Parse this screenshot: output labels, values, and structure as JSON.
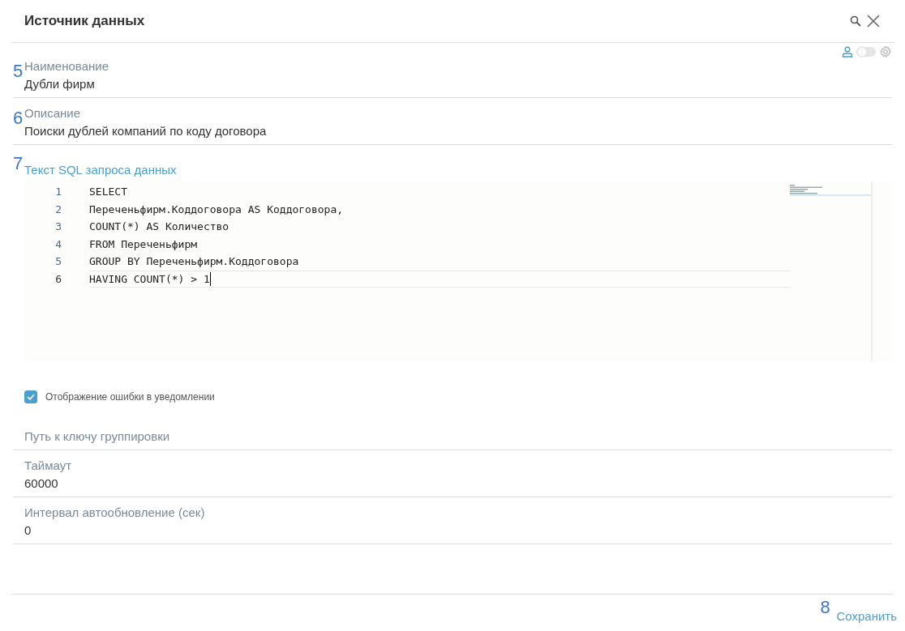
{
  "window": {
    "title": "Источник данных"
  },
  "top_fields": [
    {
      "marker": "5",
      "label": "Наименование",
      "value": "Дубли фирм"
    },
    {
      "marker": "6",
      "label": "Описание",
      "value": "Поиски дублей компаний по коду договора"
    }
  ],
  "toggle": {
    "on": false
  },
  "sql": {
    "marker": "7",
    "label": "Текст SQL запроса данных",
    "lines": [
      {
        "number": "1",
        "text": "SELECT",
        "current": false
      },
      {
        "number": "2",
        "text": "Переченьфирм.Коддоговора AS Коддоговора,",
        "current": false
      },
      {
        "number": "3",
        "text": "COUNT(*) AS Количество",
        "current": false
      },
      {
        "number": "4",
        "text": "FROM Переченьфирм",
        "current": false
      },
      {
        "number": "5",
        "text": "GROUP BY Переченьфирм.Коддоговора",
        "current": false
      },
      {
        "number": "6",
        "text": "HAVING COUNT(*) > 1",
        "current": true
      }
    ]
  },
  "error_checkbox": {
    "label": "Отображение ошибки в уведомлении",
    "checked": true
  },
  "bottom_fields": [
    {
      "placeholder": "Путь к ключу группировки"
    },
    {
      "label": "Таймаут",
      "value": "60000"
    },
    {
      "label": "Интервал автообновление (сек)",
      "value": "0"
    }
  ],
  "save": {
    "marker": "8",
    "label": "Сохранить"
  }
}
